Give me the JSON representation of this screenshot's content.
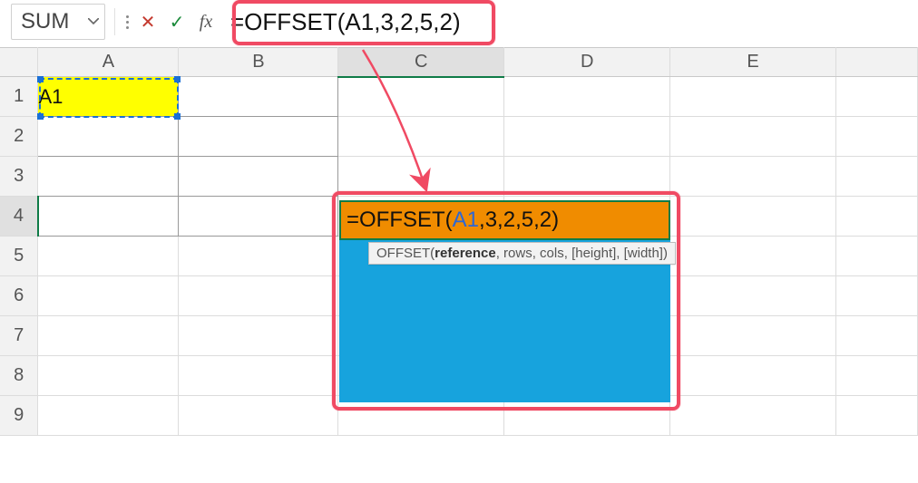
{
  "nameBox": {
    "value": "SUM"
  },
  "formulaBar": {
    "cancelGlyph": "✕",
    "enterGlyph": "✓",
    "fxLabel": "fx",
    "formulaPrefix": "=OFFSET(",
    "formulaRef": "A1",
    "formulaSuffix": ",3,2,5,2)"
  },
  "columns": [
    "A",
    "B",
    "C",
    "D",
    "E"
  ],
  "rows": [
    "1",
    "2",
    "3",
    "4",
    "5",
    "6",
    "7",
    "8",
    "9"
  ],
  "cellA1": "A1",
  "editCell": {
    "prefix": "=OFFSET(",
    "ref": "A1",
    "suffix": ",3,2,5,2)"
  },
  "tooltip": {
    "fn": "OFFSET(",
    "bold": "reference",
    "rest": ", rows, cols, [height], [width])"
  }
}
